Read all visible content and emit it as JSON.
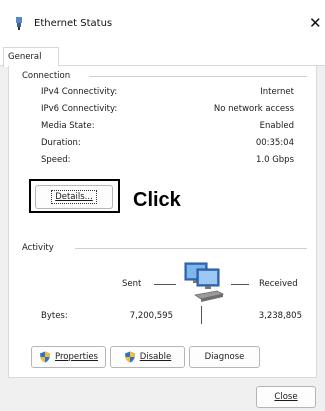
{
  "window": {
    "title": "Ethernet Status",
    "close_label": "✕"
  },
  "tabs": [
    {
      "label": "General"
    }
  ],
  "connection": {
    "title": "Connection",
    "rows": [
      {
        "label": "IPv4 Connectivity:",
        "value": "Internet"
      },
      {
        "label": "IPv6 Connectivity:",
        "value": "No network access"
      },
      {
        "label": "Media State:",
        "value": "Enabled"
      },
      {
        "label": "Duration:",
        "value": "00:35:04"
      },
      {
        "label": "Speed:",
        "value": "1.0 Gbps"
      }
    ],
    "details_button": "Details...",
    "annotation": "Click"
  },
  "activity": {
    "title": "Activity",
    "sent_label": "Sent",
    "received_label": "Received",
    "bytes_label": "Bytes:",
    "bytes_sent": "7,200,595",
    "bytes_received": "3,238,805",
    "icon": "network-computers-icon"
  },
  "buttons": {
    "properties": "Properties",
    "disable": "Disable",
    "diagnose": "Diagnose",
    "close": "Close"
  },
  "colors": {
    "shield_blue": "#2f6fd6",
    "shield_yellow": "#f2c02a",
    "highlight_border": "#000000"
  }
}
